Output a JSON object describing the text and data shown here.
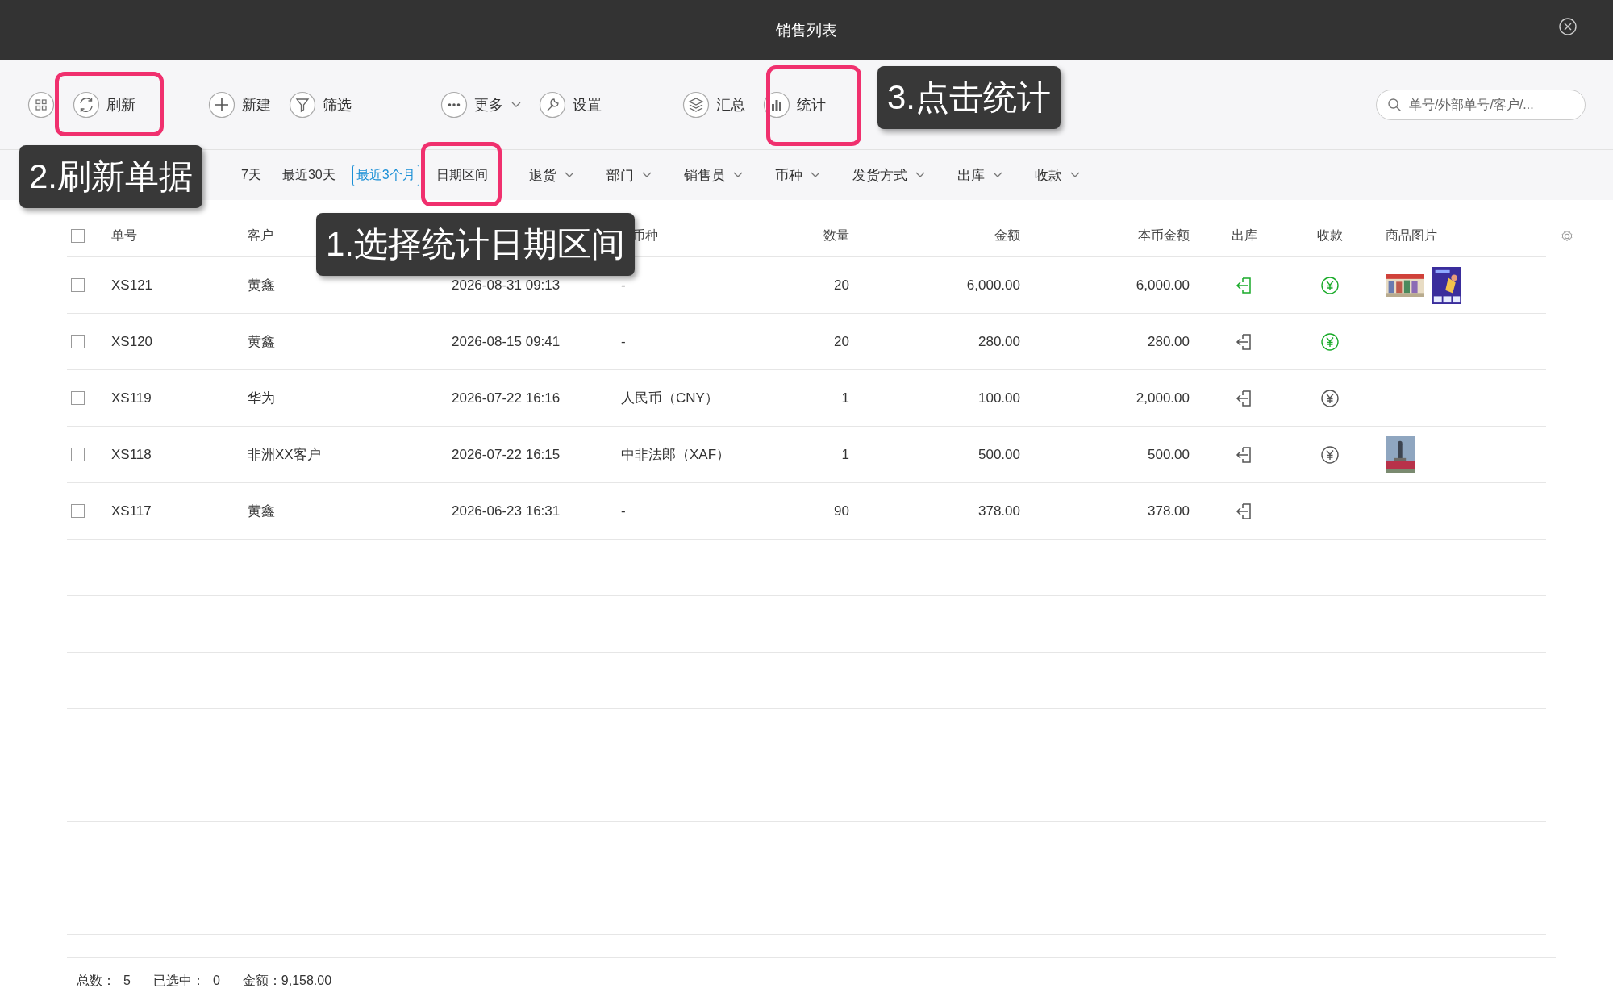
{
  "window": {
    "title": "销售列表"
  },
  "toolbar": {
    "groups": [
      [
        {
          "kind": "grid"
        },
        {
          "kind": "refresh",
          "label": "刷新"
        }
      ],
      [
        {
          "kind": "new",
          "label": "新建"
        },
        {
          "kind": "filter",
          "label": "筛选"
        }
      ],
      [
        {
          "kind": "more",
          "label": "更多",
          "caret": true
        },
        {
          "kind": "settings",
          "label": "设置"
        }
      ],
      [
        {
          "kind": "summary",
          "label": "汇总"
        },
        {
          "kind": "stats",
          "label": "统计"
        }
      ]
    ],
    "search": {
      "placeholder": "单号/外部单号/客户/..."
    }
  },
  "quick_dates": [
    {
      "label": "7天",
      "selected": false
    },
    {
      "label": "最近30天",
      "selected": false
    },
    {
      "label": "最近3个月",
      "selected": true
    },
    {
      "label": "日期区间",
      "selected": false
    }
  ],
  "filters": [
    "退货",
    "部门",
    "销售员",
    "币种",
    "发货方式",
    "出库",
    "收款"
  ],
  "table": {
    "select_all": {
      "checked": false
    },
    "columns": [
      "单号",
      "客户",
      "币种",
      "数量",
      "金额",
      "本币金额",
      "出库",
      "收款",
      "商品图片"
    ],
    "rows": [
      {
        "checked": false,
        "no": "XS121",
        "customer": "黄鑫",
        "date": "2026-08-31 09:13",
        "currency": "-",
        "qty": "20",
        "amount": "6,000.00",
        "base_amount": "6,000.00",
        "shipped": true,
        "payment": {
          "paid": true
        }
      },
      {
        "checked": false,
        "no": "XS120",
        "customer": "黄鑫",
        "date": "2026-08-15 09:41",
        "currency": "-",
        "qty": "20",
        "amount": "280.00",
        "base_amount": "280.00",
        "shipped": false,
        "payment": {
          "paid": true
        }
      },
      {
        "checked": false,
        "no": "XS119",
        "customer": "华为",
        "date": "2026-07-22 16:16",
        "currency": "人民币（CNY）",
        "qty": "1",
        "amount": "100.00",
        "base_amount": "2,000.00",
        "shipped": false,
        "payment": {
          "paid": false
        }
      },
      {
        "checked": false,
        "no": "XS118",
        "customer": "非洲XX客户",
        "date": "2026-07-22 16:15",
        "currency": "中非法郎（XAF）",
        "qty": "1",
        "amount": "500.00",
        "base_amount": "500.00",
        "shipped": false,
        "payment": {
          "paid": false
        }
      },
      {
        "checked": false,
        "no": "XS117",
        "customer": "黄鑫",
        "date": "2026-06-23 16:31",
        "currency": "-",
        "qty": "90",
        "amount": "378.00",
        "base_amount": "378.00",
        "shipped": false
      }
    ]
  },
  "footer": [
    {
      "label": "总数：",
      "value": "5"
    },
    {
      "label": "已选中：",
      "value": "0"
    },
    {
      "label": "金额：",
      "value": "9,158.00"
    }
  ],
  "annotations": [
    {
      "kind": "step1",
      "text": "1.选择统计日期区间"
    },
    {
      "kind": "step2",
      "text": "2.刷新单据"
    },
    {
      "kind": "step3",
      "text": "3.点击统计"
    }
  ]
}
